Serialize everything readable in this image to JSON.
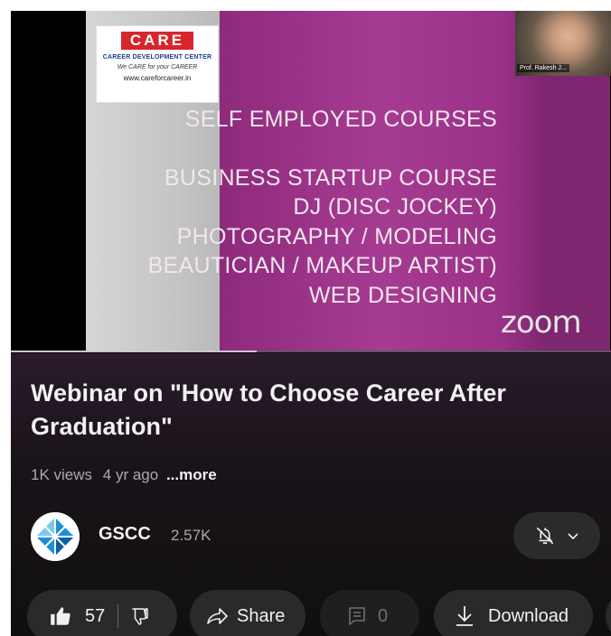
{
  "video": {
    "logo": {
      "word": "CARE",
      "subtitle": "CAREER DEVELOPMENT CENTER",
      "tagline": "We CARE for your CAREER",
      "url": "www.careforcareer.in"
    },
    "slide_lines": [
      "SELF EMPLOYED COURSES",
      "BUSINESS STARTUP COURSE",
      "DJ (DISC JOCKEY)",
      "PHOTOGRAPHY / MODELING",
      "BEAUTICIAN / MAKEUP ARTIST)",
      "WEB DESIGNING"
    ],
    "watermark": "zoom",
    "participant_name": "Prof. Rakesh J...",
    "progress_fraction": 0.41
  },
  "details": {
    "title": "Webinar on \"How to Choose Career After Graduation\"",
    "views": "1K views",
    "age": "4 yr ago",
    "more_label": "...more"
  },
  "channel": {
    "name": "GSCC",
    "subscribers": "2.57K",
    "bell_icon": "bell-off-icon",
    "avatar_colors": [
      "#1d8fd8",
      "#7cc9ef",
      "#0d5ea8"
    ]
  },
  "actions": {
    "like_count": "57",
    "share_label": "Share",
    "comment_count": "0",
    "download_label": "Download"
  },
  "colors": {
    "background": "#0f0f10",
    "pill": "#2a2a2c",
    "text_primary": "#f1f1f1",
    "text_secondary": "#aaaaaa"
  }
}
